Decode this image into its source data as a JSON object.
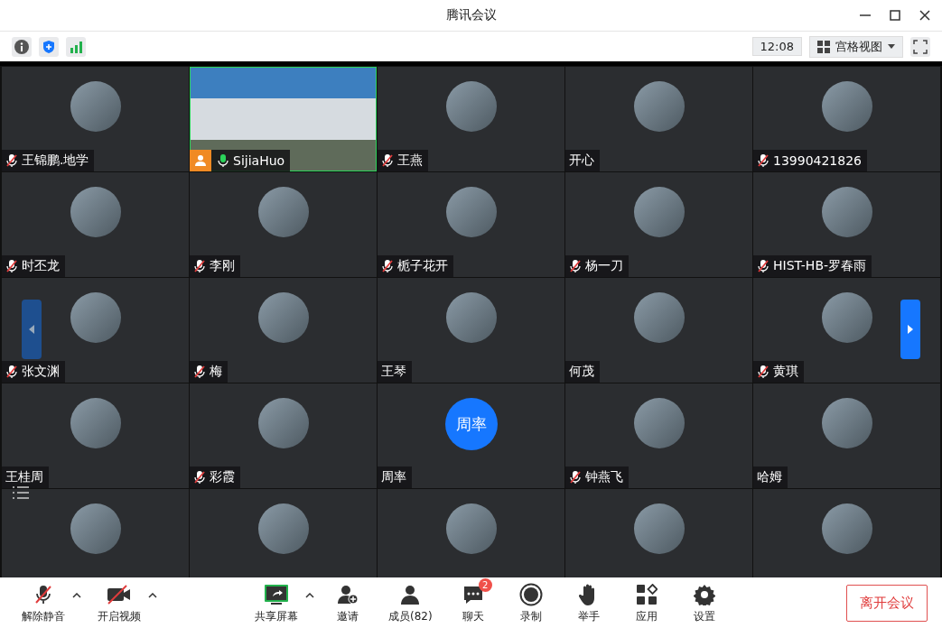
{
  "window": {
    "title": "腾讯会议"
  },
  "top_bar": {
    "time": "12:08",
    "view_mode": "宫格视图"
  },
  "tiles": [
    {
      "kind": "avatar",
      "name": "王锦鹏.地学",
      "muted": true,
      "host": false
    },
    {
      "kind": "video",
      "name": "SijiaHuo",
      "muted": false,
      "host": true
    },
    {
      "kind": "avatar",
      "name": "王燕",
      "muted": true,
      "host": false
    },
    {
      "kind": "avatar",
      "name": "开心",
      "host": false
    },
    {
      "kind": "avatar",
      "name": "13990421826",
      "muted": true,
      "host": false
    },
    {
      "kind": "avatar",
      "name": "时丕龙",
      "muted": true,
      "host": false
    },
    {
      "kind": "avatar",
      "name": "李刚",
      "muted": true,
      "host": false
    },
    {
      "kind": "avatar",
      "name": "栀子花开",
      "muted": true,
      "host": false
    },
    {
      "kind": "avatar",
      "name": "杨一刀",
      "muted": true,
      "host": false
    },
    {
      "kind": "avatar",
      "name": "HIST-HB-罗春雨",
      "muted": true,
      "host": false
    },
    {
      "kind": "avatar",
      "name": "张文渊",
      "muted": true,
      "host": false
    },
    {
      "kind": "avatar",
      "name": "梅",
      "muted": true,
      "host": false
    },
    {
      "kind": "avatar",
      "name": "王琴",
      "host": false
    },
    {
      "kind": "avatar",
      "name": "何茂",
      "host": false
    },
    {
      "kind": "avatar",
      "name": "黄琪",
      "muted": true,
      "host": false
    },
    {
      "kind": "avatar",
      "name": "王桂周",
      "host": false
    },
    {
      "kind": "avatar",
      "name": "彩霞",
      "muted": true,
      "host": false
    },
    {
      "kind": "initials",
      "initials": "周率",
      "name": "周率",
      "host": false
    },
    {
      "kind": "avatar",
      "name": "钟燕飞",
      "muted": true,
      "host": false
    },
    {
      "kind": "avatar",
      "name": "哈姆",
      "host": false
    },
    {
      "kind": "avatar"
    },
    {
      "kind": "avatar"
    },
    {
      "kind": "avatar"
    },
    {
      "kind": "avatar"
    },
    {
      "kind": "avatar"
    }
  ],
  "toolbar": [
    {
      "kind": "mic",
      "label": "解除静音",
      "menu": true
    },
    {
      "kind": "camera",
      "label": "开启视频",
      "menu": true
    },
    {
      "kind": "share",
      "label": "共享屏幕",
      "menu": true
    },
    {
      "kind": "invite",
      "label": "邀请",
      "menu": false
    },
    {
      "kind": "members",
      "label": "成员(82)",
      "menu": false
    },
    {
      "kind": "chat",
      "label": "聊天",
      "menu": false,
      "badge": "2"
    },
    {
      "kind": "record",
      "label": "录制",
      "menu": false
    },
    {
      "kind": "hand",
      "label": "举手",
      "menu": false
    },
    {
      "kind": "apps",
      "label": "应用",
      "menu": false
    },
    {
      "kind": "settings",
      "label": "设置",
      "menu": false
    }
  ],
  "leave_button": "离开会议"
}
